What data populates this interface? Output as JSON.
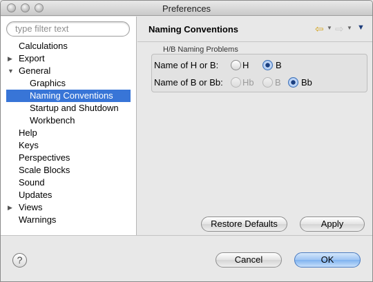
{
  "window": {
    "title": "Preferences"
  },
  "filter": {
    "placeholder": "type filter text"
  },
  "tree": [
    {
      "label": "Calculations",
      "level": 0,
      "twisty": "",
      "selected": false
    },
    {
      "label": "Export",
      "level": 0,
      "twisty": "collapsed",
      "selected": false
    },
    {
      "label": "General",
      "level": 0,
      "twisty": "expanded",
      "selected": false
    },
    {
      "label": "Graphics",
      "level": 1,
      "twisty": "",
      "selected": false
    },
    {
      "label": "Naming Conventions",
      "level": 1,
      "twisty": "",
      "selected": true
    },
    {
      "label": "Startup and Shutdown",
      "level": 1,
      "twisty": "",
      "selected": false
    },
    {
      "label": "Workbench",
      "level": 1,
      "twisty": "",
      "selected": false
    },
    {
      "label": "Help",
      "level": 0,
      "twisty": "",
      "selected": false
    },
    {
      "label": "Keys",
      "level": 0,
      "twisty": "",
      "selected": false
    },
    {
      "label": "Perspectives",
      "level": 0,
      "twisty": "",
      "selected": false
    },
    {
      "label": "Scale Blocks",
      "level": 0,
      "twisty": "",
      "selected": false
    },
    {
      "label": "Sound",
      "level": 0,
      "twisty": "",
      "selected": false
    },
    {
      "label": "Updates",
      "level": 0,
      "twisty": "",
      "selected": false
    },
    {
      "label": "Views",
      "level": 0,
      "twisty": "collapsed",
      "selected": false
    },
    {
      "label": "Warnings",
      "level": 0,
      "twisty": "",
      "selected": false
    }
  ],
  "page": {
    "title": "Naming Conventions",
    "nav": {
      "back_icon": "back-arrow-icon",
      "forward_icon": "forward-arrow-icon",
      "menu_icon": "view-menu-icon"
    }
  },
  "group": {
    "title": "H/B Naming Problems",
    "row1": {
      "label": "Name of H or B:",
      "options": [
        {
          "label": "H",
          "checked": false,
          "enabled": true
        },
        {
          "label": "B",
          "checked": true,
          "enabled": true
        }
      ]
    },
    "row2": {
      "label": "Name of B or Bb:",
      "options": [
        {
          "label": "Hb",
          "checked": false,
          "enabled": false
        },
        {
          "label": "B",
          "checked": false,
          "enabled": false
        },
        {
          "label": "Bb",
          "checked": true,
          "enabled": true
        }
      ]
    }
  },
  "buttons": {
    "restore_defaults": "Restore Defaults",
    "apply": "Apply",
    "cancel": "Cancel",
    "ok": "OK",
    "help": "?"
  }
}
